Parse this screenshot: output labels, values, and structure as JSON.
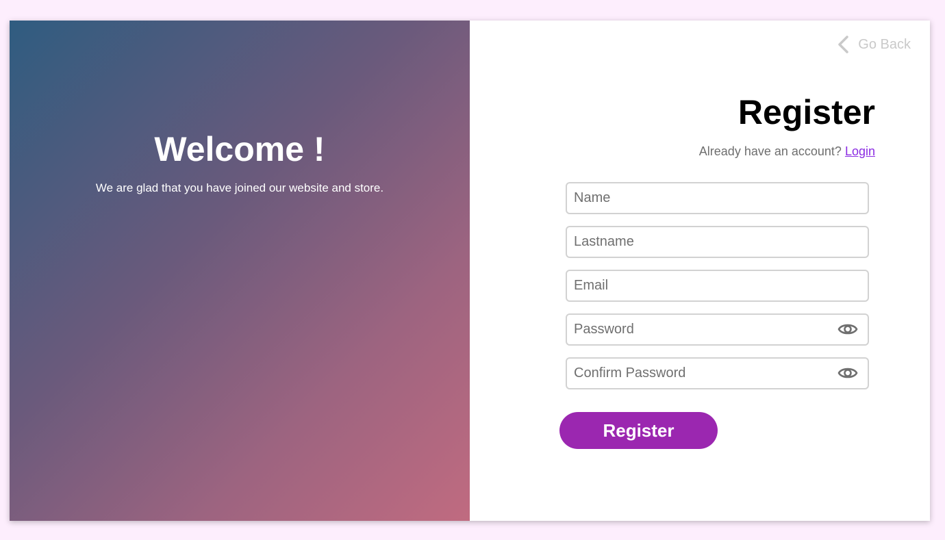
{
  "welcome": {
    "title": "Welcome !",
    "subtitle": "We are glad that you have joined our website and store."
  },
  "nav": {
    "go_back_label": "Go Back",
    "go_back_icon": "chevron-left-icon"
  },
  "form": {
    "title": "Register",
    "account_prompt": "Already have an account?",
    "login_link": "Login",
    "fields": {
      "name": {
        "placeholder": "Name",
        "value": ""
      },
      "lastname": {
        "placeholder": "Lastname",
        "value": ""
      },
      "email": {
        "placeholder": "Email",
        "value": ""
      },
      "password": {
        "placeholder": "Password",
        "value": "",
        "icon": "eye-icon"
      },
      "confirm_password": {
        "placeholder": "Confirm Password",
        "value": "",
        "icon": "eye-icon"
      }
    },
    "submit_label": "Register"
  },
  "colors": {
    "page_background": "#fdeefd",
    "gradient_start": "#2f5c80",
    "gradient_end": "#c06b80",
    "accent": "#9b27b0",
    "link": "#8a2be2"
  }
}
